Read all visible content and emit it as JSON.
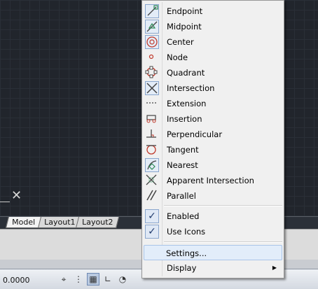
{
  "model_tabs": [
    "Model",
    "Layout1",
    "Layout2"
  ],
  "coordinates": "0.0000",
  "snap_menu": {
    "items": [
      {
        "label": "Endpoint",
        "icon": "endpoint-icon",
        "checked": true
      },
      {
        "label": "Midpoint",
        "icon": "midpoint-icon",
        "checked": true
      },
      {
        "label": "Center",
        "icon": "center-icon",
        "checked": true
      },
      {
        "label": "Node",
        "icon": "node-icon",
        "checked": false
      },
      {
        "label": "Quadrant",
        "icon": "quadrant-icon",
        "checked": false
      },
      {
        "label": "Intersection",
        "icon": "intersection-icon",
        "checked": true
      },
      {
        "label": "Extension",
        "icon": "extension-icon",
        "checked": false
      },
      {
        "label": "Insertion",
        "icon": "insertion-icon",
        "checked": false
      },
      {
        "label": "Perpendicular",
        "icon": "perpendicular-icon",
        "checked": false
      },
      {
        "label": "Tangent",
        "icon": "tangent-icon",
        "checked": false
      },
      {
        "label": "Nearest",
        "icon": "nearest-icon",
        "checked": true
      },
      {
        "label": "Apparent Intersection",
        "icon": "apparent-intersection-icon",
        "checked": false
      },
      {
        "label": "Parallel",
        "icon": "parallel-icon",
        "checked": false
      }
    ],
    "toggles": [
      {
        "label": "Enabled",
        "checked": true
      },
      {
        "label": "Use Icons",
        "checked": true
      }
    ],
    "settings_label": "Settings...",
    "display_label": "Display"
  },
  "status_buttons": [
    {
      "name": "snap-mode-icon",
      "glyph": "⌖",
      "on": false
    },
    {
      "name": "grid-dots-icon",
      "glyph": "⋮",
      "on": false
    },
    {
      "name": "grid-display-icon",
      "glyph": "▦",
      "on": true
    },
    {
      "name": "ortho-icon",
      "glyph": "∟",
      "on": false
    },
    {
      "name": "polar-icon",
      "glyph": "◔",
      "on": false
    }
  ],
  "colors": {
    "canvas": "#21252c",
    "menu_bg": "#f0f0f0",
    "highlight": "#e2edfa",
    "icon_frame": "#8aa6cd"
  }
}
